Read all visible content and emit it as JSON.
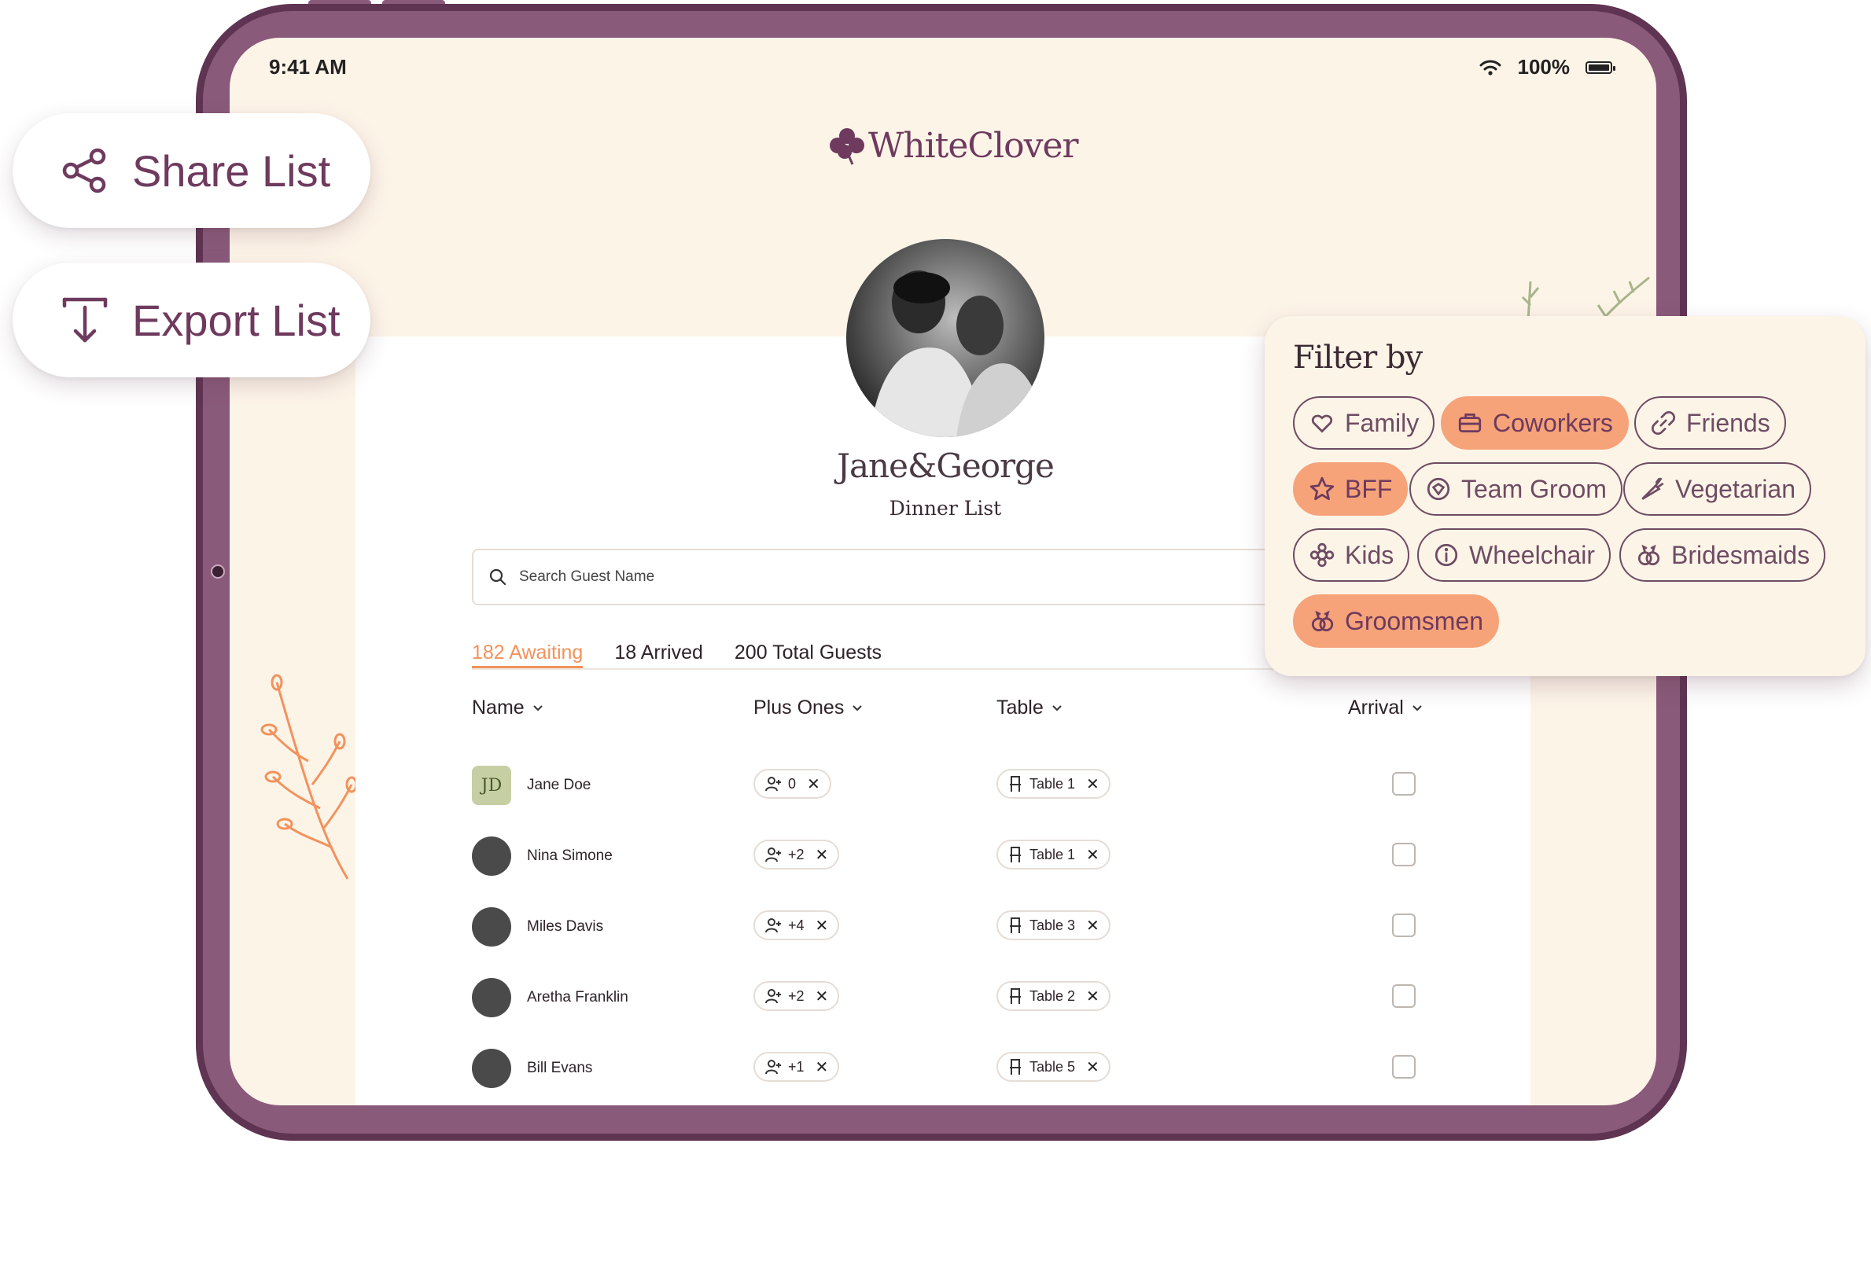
{
  "floating": {
    "share_label": "Share List",
    "export_label": "Export List"
  },
  "status": {
    "time": "9:41 AM",
    "battery": "100%",
    "battery_level": 1.0
  },
  "app": {
    "logo_text": "WhiteClover"
  },
  "event": {
    "couple": "Jane&George",
    "list_title": "Dinner List"
  },
  "search": {
    "placeholder": "Search Guest Name"
  },
  "tabs": {
    "awaiting": "182  Awaiting",
    "arrived": "18  Arrived",
    "total": "200  Total Guests"
  },
  "columns": {
    "name": "Name",
    "plus_ones": "Plus Ones",
    "table": "Table",
    "arrival": "Arrival"
  },
  "guests": [
    {
      "initials": "JD",
      "name": "Jane  Doe",
      "plus": "0",
      "table": "Table 1"
    },
    {
      "initials": "",
      "name": "Nina Simone",
      "plus": "+2",
      "table": "Table 1"
    },
    {
      "initials": "",
      "name": "Miles  Davis",
      "plus": "+4",
      "table": "Table 3"
    },
    {
      "initials": "",
      "name": "Aretha  Franklin",
      "plus": "+2",
      "table": "Table 2"
    },
    {
      "initials": "",
      "name": "Bill  Evans",
      "plus": "+1",
      "table": "Table 5"
    }
  ],
  "filter": {
    "title": "Filter by",
    "options": [
      {
        "label": "Family",
        "active": false
      },
      {
        "label": "Coworkers",
        "active": true
      },
      {
        "label": "Friends",
        "active": false
      },
      {
        "label": "BFF",
        "active": true
      },
      {
        "label": "Team Groom",
        "active": false
      },
      {
        "label": "Vegetarian",
        "active": false
      },
      {
        "label": "Kids",
        "active": false
      },
      {
        "label": "Wheelchair",
        "active": false
      },
      {
        "label": "Bridesmaids",
        "active": false
      },
      {
        "label": "Groomsmen",
        "active": true
      }
    ]
  },
  "colors": {
    "frame": "#8a5a7a",
    "brand": "#6e3a5e",
    "accent": "#f6a37a",
    "active_tab": "#f2925c",
    "cream": "#fdf4e8"
  }
}
